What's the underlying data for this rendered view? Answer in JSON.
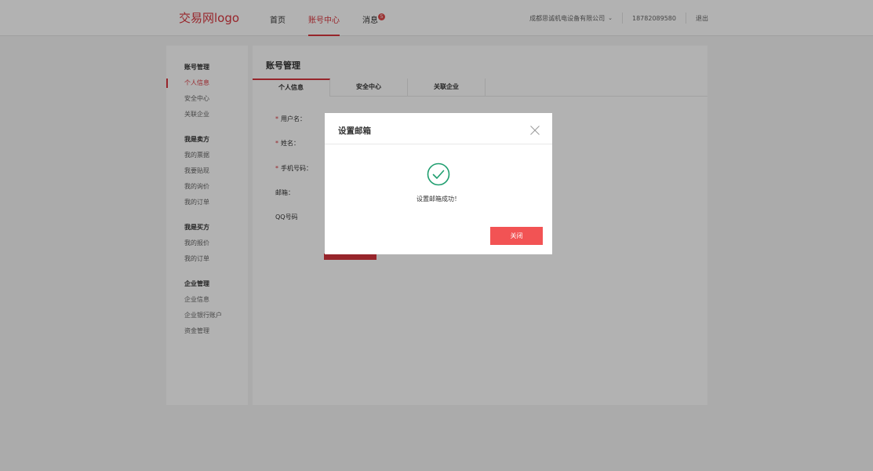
{
  "header": {
    "logo": "交易网logo",
    "nav": [
      {
        "label": "首页"
      },
      {
        "label": "账号中心"
      },
      {
        "label": "消息",
        "badge": "5"
      }
    ],
    "company": "成都思诚机电设备有限公司",
    "phone": "18782089580",
    "logout": "退出"
  },
  "sidebar": {
    "groups": [
      {
        "title": "账号管理",
        "items": [
          "个人信息",
          "安全中心",
          "关联企业"
        ]
      },
      {
        "title": "我是卖方",
        "items": [
          "我的票据",
          "我要贴现",
          "我的询价",
          "我的订单"
        ]
      },
      {
        "title": "我是买方",
        "items": [
          "我的报价",
          "我的订单"
        ]
      },
      {
        "title": "企业管理",
        "items": [
          "企业信息",
          "企业银行账户",
          "资金管理"
        ]
      }
    ]
  },
  "main": {
    "title": "账号管理",
    "tabs": [
      "个人信息",
      "安全中心",
      "关联企业"
    ],
    "form": {
      "username_label": "用户名：",
      "name_label": "姓名：",
      "phone_label": "手机号码：",
      "email_label": "邮箱：",
      "qq_label": "QQ号码"
    },
    "required_mark": "*"
  },
  "modal": {
    "title": "设置邮箱",
    "message": "设置邮箱成功！",
    "close_button": "关闭"
  },
  "colors": {
    "accent": "#d9363e",
    "button": "#f25354",
    "success": "#1f9e6f"
  }
}
